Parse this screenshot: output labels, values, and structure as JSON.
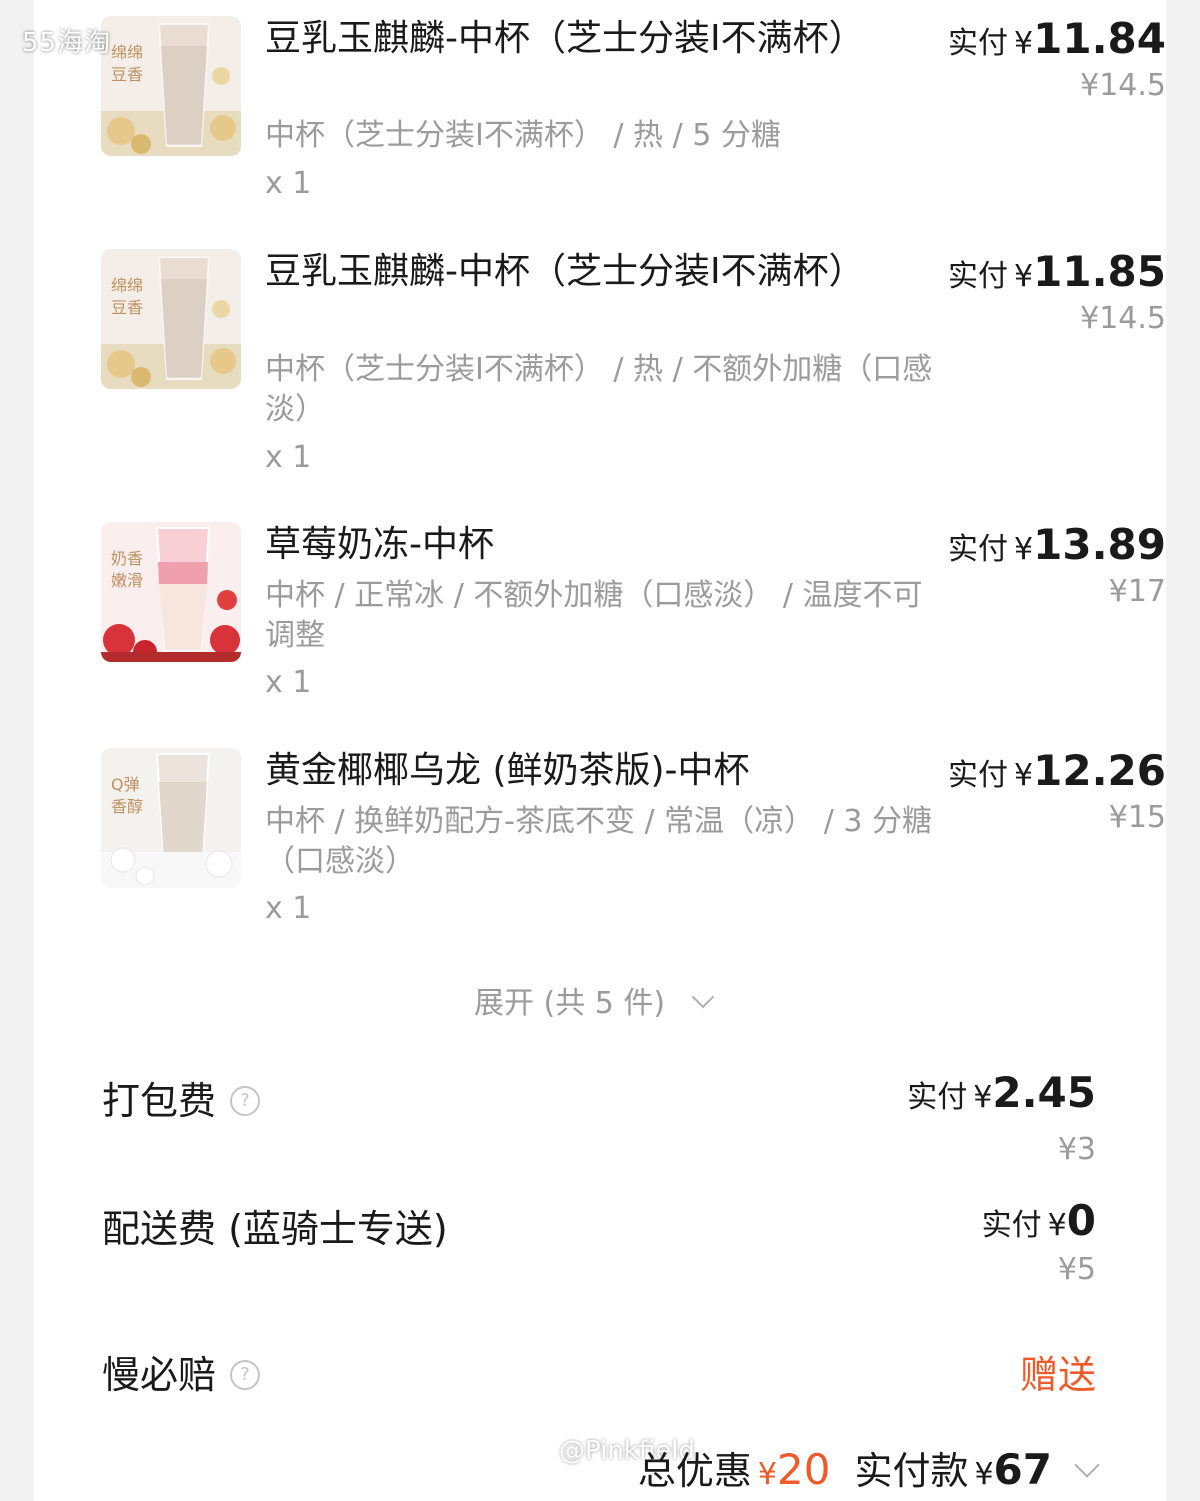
{
  "watermark": {
    "top": "55海淘",
    "bottom": "@Pinkfield"
  },
  "items": [
    {
      "tag": "绵绵豆香",
      "title": "豆乳玉麒麟-中杯（芝士分装I不满杯）",
      "options": "中杯（芝士分装I不满杯） / 热 / 5 分糖",
      "qty": "x 1",
      "paid_label": "实付",
      "currency": "¥",
      "paid": "11.84",
      "original": "¥14.5"
    },
    {
      "tag": "绵绵豆香",
      "title": "豆乳玉麒麟-中杯（芝士分装I不满杯）",
      "options": "中杯（芝士分装I不满杯） / 热 / 不额外加糖（口感淡）",
      "qty": "x 1",
      "paid_label": "实付",
      "currency": "¥",
      "paid": "11.85",
      "original": "¥14.5"
    },
    {
      "tag": "奶香嫩滑",
      "title": "草莓奶冻-中杯",
      "options": "中杯 / 正常冰 / 不额外加糖（口感淡） / 温度不可调整",
      "qty": "x 1",
      "paid_label": "实付",
      "currency": "¥",
      "paid": "13.89",
      "original": "¥17"
    },
    {
      "tag": "Q弹香醇",
      "title": "黄金椰椰乌龙 (鲜奶茶版)-中杯",
      "options": "中杯 / 换鲜奶配方-茶底不变 / 常温（凉） / 3 分糖（口感淡）",
      "qty": "x 1",
      "paid_label": "实付",
      "currency": "¥",
      "paid": "12.26",
      "original": "¥15"
    }
  ],
  "expand": {
    "label": "展开 (共 5 件)"
  },
  "fees": {
    "packing": {
      "label": "打包费",
      "paid_label": "实付",
      "currency": "¥",
      "paid": "2.45",
      "original": "¥3"
    },
    "delivery": {
      "label": "配送费 (蓝骑士专送)",
      "paid_label": "实付",
      "currency": "¥",
      "paid": "0",
      "original": "¥5"
    },
    "guarantee": {
      "label": "慢必赔",
      "value": "赠送"
    }
  },
  "summary": {
    "discount_label": "总优惠",
    "discount_currency": "¥",
    "discount": "20",
    "paid_label": "实付款",
    "paid_currency": "¥",
    "paid": "67"
  },
  "icons": [
    "help-circle-icon",
    "chevron-down-icon"
  ],
  "colors": {
    "accent": "#f05a28",
    "muted": "#9b9b9b",
    "text": "#1a1a1a"
  }
}
